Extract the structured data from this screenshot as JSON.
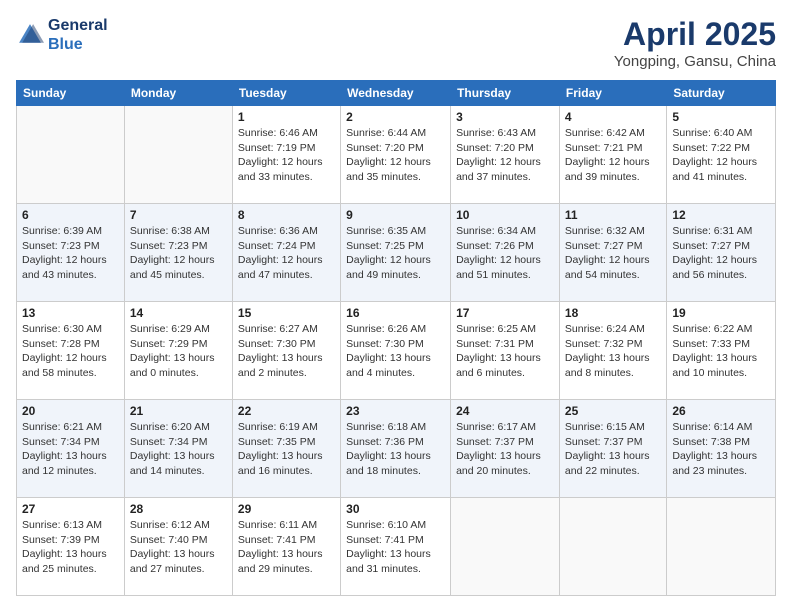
{
  "header": {
    "logo_line1": "General",
    "logo_line2": "Blue",
    "title": "April 2025",
    "subtitle": "Yongping, Gansu, China"
  },
  "weekdays": [
    "Sunday",
    "Monday",
    "Tuesday",
    "Wednesday",
    "Thursday",
    "Friday",
    "Saturday"
  ],
  "weeks": [
    [
      {
        "num": "",
        "sunrise": "",
        "sunset": "",
        "daylight": ""
      },
      {
        "num": "",
        "sunrise": "",
        "sunset": "",
        "daylight": ""
      },
      {
        "num": "1",
        "sunrise": "Sunrise: 6:46 AM",
        "sunset": "Sunset: 7:19 PM",
        "daylight": "Daylight: 12 hours and 33 minutes."
      },
      {
        "num": "2",
        "sunrise": "Sunrise: 6:44 AM",
        "sunset": "Sunset: 7:20 PM",
        "daylight": "Daylight: 12 hours and 35 minutes."
      },
      {
        "num": "3",
        "sunrise": "Sunrise: 6:43 AM",
        "sunset": "Sunset: 7:20 PM",
        "daylight": "Daylight: 12 hours and 37 minutes."
      },
      {
        "num": "4",
        "sunrise": "Sunrise: 6:42 AM",
        "sunset": "Sunset: 7:21 PM",
        "daylight": "Daylight: 12 hours and 39 minutes."
      },
      {
        "num": "5",
        "sunrise": "Sunrise: 6:40 AM",
        "sunset": "Sunset: 7:22 PM",
        "daylight": "Daylight: 12 hours and 41 minutes."
      }
    ],
    [
      {
        "num": "6",
        "sunrise": "Sunrise: 6:39 AM",
        "sunset": "Sunset: 7:23 PM",
        "daylight": "Daylight: 12 hours and 43 minutes."
      },
      {
        "num": "7",
        "sunrise": "Sunrise: 6:38 AM",
        "sunset": "Sunset: 7:23 PM",
        "daylight": "Daylight: 12 hours and 45 minutes."
      },
      {
        "num": "8",
        "sunrise": "Sunrise: 6:36 AM",
        "sunset": "Sunset: 7:24 PM",
        "daylight": "Daylight: 12 hours and 47 minutes."
      },
      {
        "num": "9",
        "sunrise": "Sunrise: 6:35 AM",
        "sunset": "Sunset: 7:25 PM",
        "daylight": "Daylight: 12 hours and 49 minutes."
      },
      {
        "num": "10",
        "sunrise": "Sunrise: 6:34 AM",
        "sunset": "Sunset: 7:26 PM",
        "daylight": "Daylight: 12 hours and 51 minutes."
      },
      {
        "num": "11",
        "sunrise": "Sunrise: 6:32 AM",
        "sunset": "Sunset: 7:27 PM",
        "daylight": "Daylight: 12 hours and 54 minutes."
      },
      {
        "num": "12",
        "sunrise": "Sunrise: 6:31 AM",
        "sunset": "Sunset: 7:27 PM",
        "daylight": "Daylight: 12 hours and 56 minutes."
      }
    ],
    [
      {
        "num": "13",
        "sunrise": "Sunrise: 6:30 AM",
        "sunset": "Sunset: 7:28 PM",
        "daylight": "Daylight: 12 hours and 58 minutes."
      },
      {
        "num": "14",
        "sunrise": "Sunrise: 6:29 AM",
        "sunset": "Sunset: 7:29 PM",
        "daylight": "Daylight: 13 hours and 0 minutes."
      },
      {
        "num": "15",
        "sunrise": "Sunrise: 6:27 AM",
        "sunset": "Sunset: 7:30 PM",
        "daylight": "Daylight: 13 hours and 2 minutes."
      },
      {
        "num": "16",
        "sunrise": "Sunrise: 6:26 AM",
        "sunset": "Sunset: 7:30 PM",
        "daylight": "Daylight: 13 hours and 4 minutes."
      },
      {
        "num": "17",
        "sunrise": "Sunrise: 6:25 AM",
        "sunset": "Sunset: 7:31 PM",
        "daylight": "Daylight: 13 hours and 6 minutes."
      },
      {
        "num": "18",
        "sunrise": "Sunrise: 6:24 AM",
        "sunset": "Sunset: 7:32 PM",
        "daylight": "Daylight: 13 hours and 8 minutes."
      },
      {
        "num": "19",
        "sunrise": "Sunrise: 6:22 AM",
        "sunset": "Sunset: 7:33 PM",
        "daylight": "Daylight: 13 hours and 10 minutes."
      }
    ],
    [
      {
        "num": "20",
        "sunrise": "Sunrise: 6:21 AM",
        "sunset": "Sunset: 7:34 PM",
        "daylight": "Daylight: 13 hours and 12 minutes."
      },
      {
        "num": "21",
        "sunrise": "Sunrise: 6:20 AM",
        "sunset": "Sunset: 7:34 PM",
        "daylight": "Daylight: 13 hours and 14 minutes."
      },
      {
        "num": "22",
        "sunrise": "Sunrise: 6:19 AM",
        "sunset": "Sunset: 7:35 PM",
        "daylight": "Daylight: 13 hours and 16 minutes."
      },
      {
        "num": "23",
        "sunrise": "Sunrise: 6:18 AM",
        "sunset": "Sunset: 7:36 PM",
        "daylight": "Daylight: 13 hours and 18 minutes."
      },
      {
        "num": "24",
        "sunrise": "Sunrise: 6:17 AM",
        "sunset": "Sunset: 7:37 PM",
        "daylight": "Daylight: 13 hours and 20 minutes."
      },
      {
        "num": "25",
        "sunrise": "Sunrise: 6:15 AM",
        "sunset": "Sunset: 7:37 PM",
        "daylight": "Daylight: 13 hours and 22 minutes."
      },
      {
        "num": "26",
        "sunrise": "Sunrise: 6:14 AM",
        "sunset": "Sunset: 7:38 PM",
        "daylight": "Daylight: 13 hours and 23 minutes."
      }
    ],
    [
      {
        "num": "27",
        "sunrise": "Sunrise: 6:13 AM",
        "sunset": "Sunset: 7:39 PM",
        "daylight": "Daylight: 13 hours and 25 minutes."
      },
      {
        "num": "28",
        "sunrise": "Sunrise: 6:12 AM",
        "sunset": "Sunset: 7:40 PM",
        "daylight": "Daylight: 13 hours and 27 minutes."
      },
      {
        "num": "29",
        "sunrise": "Sunrise: 6:11 AM",
        "sunset": "Sunset: 7:41 PM",
        "daylight": "Daylight: 13 hours and 29 minutes."
      },
      {
        "num": "30",
        "sunrise": "Sunrise: 6:10 AM",
        "sunset": "Sunset: 7:41 PM",
        "daylight": "Daylight: 13 hours and 31 minutes."
      },
      {
        "num": "",
        "sunrise": "",
        "sunset": "",
        "daylight": ""
      },
      {
        "num": "",
        "sunrise": "",
        "sunset": "",
        "daylight": ""
      },
      {
        "num": "",
        "sunrise": "",
        "sunset": "",
        "daylight": ""
      }
    ]
  ]
}
